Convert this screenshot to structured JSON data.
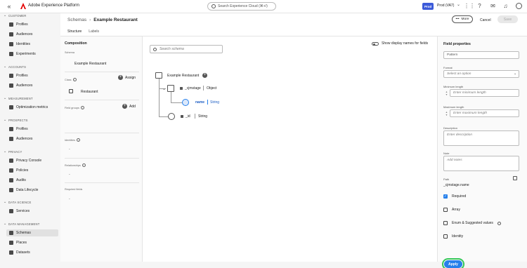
{
  "topbar": {
    "app_title": "Adobe Experience Platform",
    "search_placeholder": "Search Experience Cloud (⌘+/)",
    "sandbox_badge": "Prod",
    "sandbox_label": "Prod (VA7)"
  },
  "sidebar": {
    "sections": [
      {
        "title": "CUSTOMER",
        "items": [
          "Profiles",
          "Audiences",
          "Identities",
          "Experiments"
        ]
      },
      {
        "title": "ACCOUNTS",
        "items": [
          "Profiles",
          "Audiences"
        ]
      },
      {
        "title": "MEASUREMENT",
        "items": [
          "Optimization metrics"
        ]
      },
      {
        "title": "PROSPECTS",
        "items": [
          "Profiles",
          "Audiences"
        ]
      },
      {
        "title": "PRIVACY",
        "items": [
          "Privacy Console",
          "Policies",
          "Audits",
          "Data Lifecycle"
        ]
      },
      {
        "title": "DATA SCIENCE",
        "items": [
          "Services"
        ]
      },
      {
        "title": "DATA MANAGEMENT",
        "items": [
          "Schemas",
          "Places",
          "Datasets"
        ]
      }
    ],
    "active_item": "Schemas"
  },
  "header": {
    "breadcrumb_parent": "Schemas",
    "breadcrumb_sep": "›",
    "breadcrumb_current": "Example Restaurant",
    "more_label": "More",
    "cancel_label": "Cancel",
    "save_label": "Save",
    "tabs": [
      "Structure",
      "Labels"
    ]
  },
  "composition": {
    "title": "Composition",
    "schema_label": "Schema",
    "schema_value": "Example Restaurant",
    "class_label": "Class",
    "assign_label": "Assign",
    "class_value": "Restaurant",
    "field_groups_label": "Field groups",
    "add_label": "Add",
    "identities_label": "Identities",
    "identities_value": "-",
    "relationships_label": "Relationships",
    "relationships_value": "-",
    "required_label": "Required fields",
    "required_value": "-"
  },
  "canvas": {
    "search_placeholder": "Search schema",
    "toggle_label": "Show display names for fields",
    "root_name": "Example Restaurant",
    "node1_name": "_cjmstage",
    "node1_type": "Object",
    "node2_name": "name",
    "node2_type": "String",
    "node3_name": "_id",
    "node3_type": "String"
  },
  "properties": {
    "title": "Field properties",
    "pattern_placeholder": "Pattern",
    "format_label": "Format",
    "format_placeholder": "Select an option",
    "min_label": "Minimum length",
    "min_placeholder": "Enter minimum length",
    "max_label": "Maximum length",
    "max_placeholder": "Enter maximum length",
    "description_label": "Description",
    "description_placeholder": "Enter description",
    "note_label": "Note",
    "note_placeholder": "Add notes",
    "path_label": "Path",
    "path_value": "_cjmstage.name",
    "required_label": "Required",
    "array_label": "Array",
    "enum_label": "Enum & Suggested values",
    "identity_label": "Identity",
    "apply_label": "Apply"
  },
  "colors": {
    "accent": "#2680eb",
    "adobe_red": "#e40000",
    "sandbox_badge": "#3c5bd9"
  }
}
